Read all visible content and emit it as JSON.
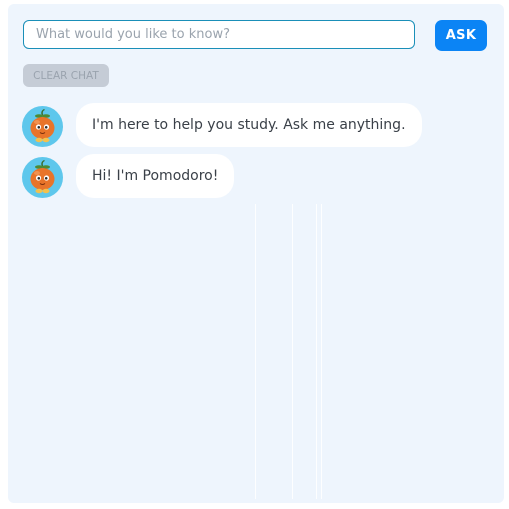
{
  "chat": {
    "input": {
      "placeholder": "What would you like to know?",
      "value": ""
    },
    "ask_label": "ASK",
    "clear_label": "CLEAR CHAT",
    "messages": [
      {
        "sender": "Pomodoro",
        "text": "I'm here to help you study. Ask me anything."
      },
      {
        "sender": "Pomodoro",
        "text": "Hi! I'm Pomodoro!"
      }
    ]
  },
  "colors": {
    "panel_background": "#eef5fd",
    "input_border": "#1a8fb8",
    "ask_button": "#0b84f5",
    "clear_button": "#c5ccd6",
    "avatar_background": "#5ec7ec",
    "avatar_character": "#e8742a"
  },
  "icons": {
    "avatar": "pomodoro-tomato-avatar-icon"
  }
}
